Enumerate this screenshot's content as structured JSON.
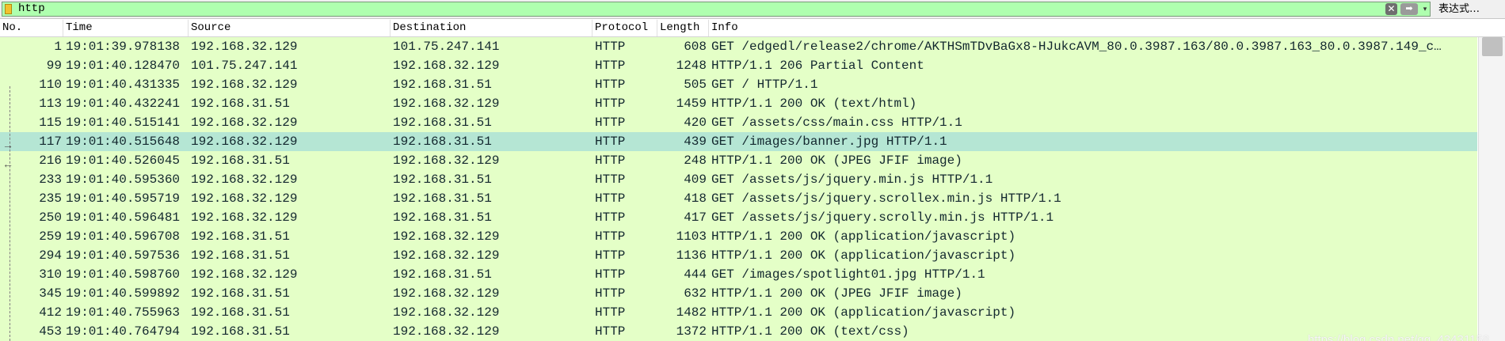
{
  "filter": {
    "value": "http",
    "expression_label": "表达式…",
    "clear_glyph": "✕",
    "apply_glyph": "➡",
    "dropdown_glyph": "▾",
    "input_bg": "#afffaf"
  },
  "columns": [
    "No.",
    "Time",
    "Source",
    "Destination",
    "Protocol",
    "Length",
    "Info"
  ],
  "row_colors": {
    "default": "#e4ffc7",
    "selected": "#b5e6d4",
    "text": "#12272e"
  },
  "selected_packet": "117",
  "packets": [
    {
      "no": "1",
      "time": "19:01:39.978138",
      "src": "192.168.32.129",
      "dst": "101.75.247.141",
      "proto": "HTTP",
      "len": "608",
      "info": "GET /edgedl/release2/chrome/AKTHSmTDvBaGx8-HJukcAVM_80.0.3987.163/80.0.3987.163_80.0.3987.149_c…"
    },
    {
      "no": "99",
      "time": "19:01:40.128470",
      "src": "101.75.247.141",
      "dst": "192.168.32.129",
      "proto": "HTTP",
      "len": "1248",
      "info": "HTTP/1.1 206 Partial Content"
    },
    {
      "no": "110",
      "time": "19:01:40.431335",
      "src": "192.168.32.129",
      "dst": "192.168.31.51",
      "proto": "HTTP",
      "len": "505",
      "info": "GET / HTTP/1.1"
    },
    {
      "no": "113",
      "time": "19:01:40.432241",
      "src": "192.168.31.51",
      "dst": "192.168.32.129",
      "proto": "HTTP",
      "len": "1459",
      "info": "HTTP/1.1 200 OK  (text/html)"
    },
    {
      "no": "115",
      "time": "19:01:40.515141",
      "src": "192.168.32.129",
      "dst": "192.168.31.51",
      "proto": "HTTP",
      "len": "420",
      "info": "GET /assets/css/main.css HTTP/1.1"
    },
    {
      "no": "117",
      "time": "19:01:40.515648",
      "src": "192.168.32.129",
      "dst": "192.168.31.51",
      "proto": "HTTP",
      "len": "439",
      "info": "GET /images/banner.jpg HTTP/1.1"
    },
    {
      "no": "216",
      "time": "19:01:40.526045",
      "src": "192.168.31.51",
      "dst": "192.168.32.129",
      "proto": "HTTP",
      "len": "248",
      "info": "HTTP/1.1 200 OK  (JPEG JFIF image)"
    },
    {
      "no": "233",
      "time": "19:01:40.595360",
      "src": "192.168.32.129",
      "dst": "192.168.31.51",
      "proto": "HTTP",
      "len": "409",
      "info": "GET /assets/js/jquery.min.js HTTP/1.1"
    },
    {
      "no": "235",
      "time": "19:01:40.595719",
      "src": "192.168.32.129",
      "dst": "192.168.31.51",
      "proto": "HTTP",
      "len": "418",
      "info": "GET /assets/js/jquery.scrollex.min.js HTTP/1.1"
    },
    {
      "no": "250",
      "time": "19:01:40.596481",
      "src": "192.168.32.129",
      "dst": "192.168.31.51",
      "proto": "HTTP",
      "len": "417",
      "info": "GET /assets/js/jquery.scrolly.min.js HTTP/1.1"
    },
    {
      "no": "259",
      "time": "19:01:40.596708",
      "src": "192.168.31.51",
      "dst": "192.168.32.129",
      "proto": "HTTP",
      "len": "1103",
      "info": "HTTP/1.1 200 OK  (application/javascript)"
    },
    {
      "no": "294",
      "time": "19:01:40.597536",
      "src": "192.168.31.51",
      "dst": "192.168.32.129",
      "proto": "HTTP",
      "len": "1136",
      "info": "HTTP/1.1 200 OK  (application/javascript)"
    },
    {
      "no": "310",
      "time": "19:01:40.598760",
      "src": "192.168.32.129",
      "dst": "192.168.31.51",
      "proto": "HTTP",
      "len": "444",
      "info": "GET /images/spotlight01.jpg HTTP/1.1"
    },
    {
      "no": "345",
      "time": "19:01:40.599892",
      "src": "192.168.31.51",
      "dst": "192.168.32.129",
      "proto": "HTTP",
      "len": "632",
      "info": "HTTP/1.1 200 OK  (JPEG JFIF image)"
    },
    {
      "no": "412",
      "time": "19:01:40.755963",
      "src": "192.168.31.51",
      "dst": "192.168.32.129",
      "proto": "HTTP",
      "len": "1482",
      "info": "HTTP/1.1 200 OK  (application/javascript)"
    },
    {
      "no": "453",
      "time": "19:01:40.764794",
      "src": "192.168.31.51",
      "dst": "192.168.32.129",
      "proto": "HTTP",
      "len": "1372",
      "info": "HTTP/1.1 200 OK  (text/css)"
    }
  ],
  "watermark": "https://blog.csdn.net/qq_43431158"
}
